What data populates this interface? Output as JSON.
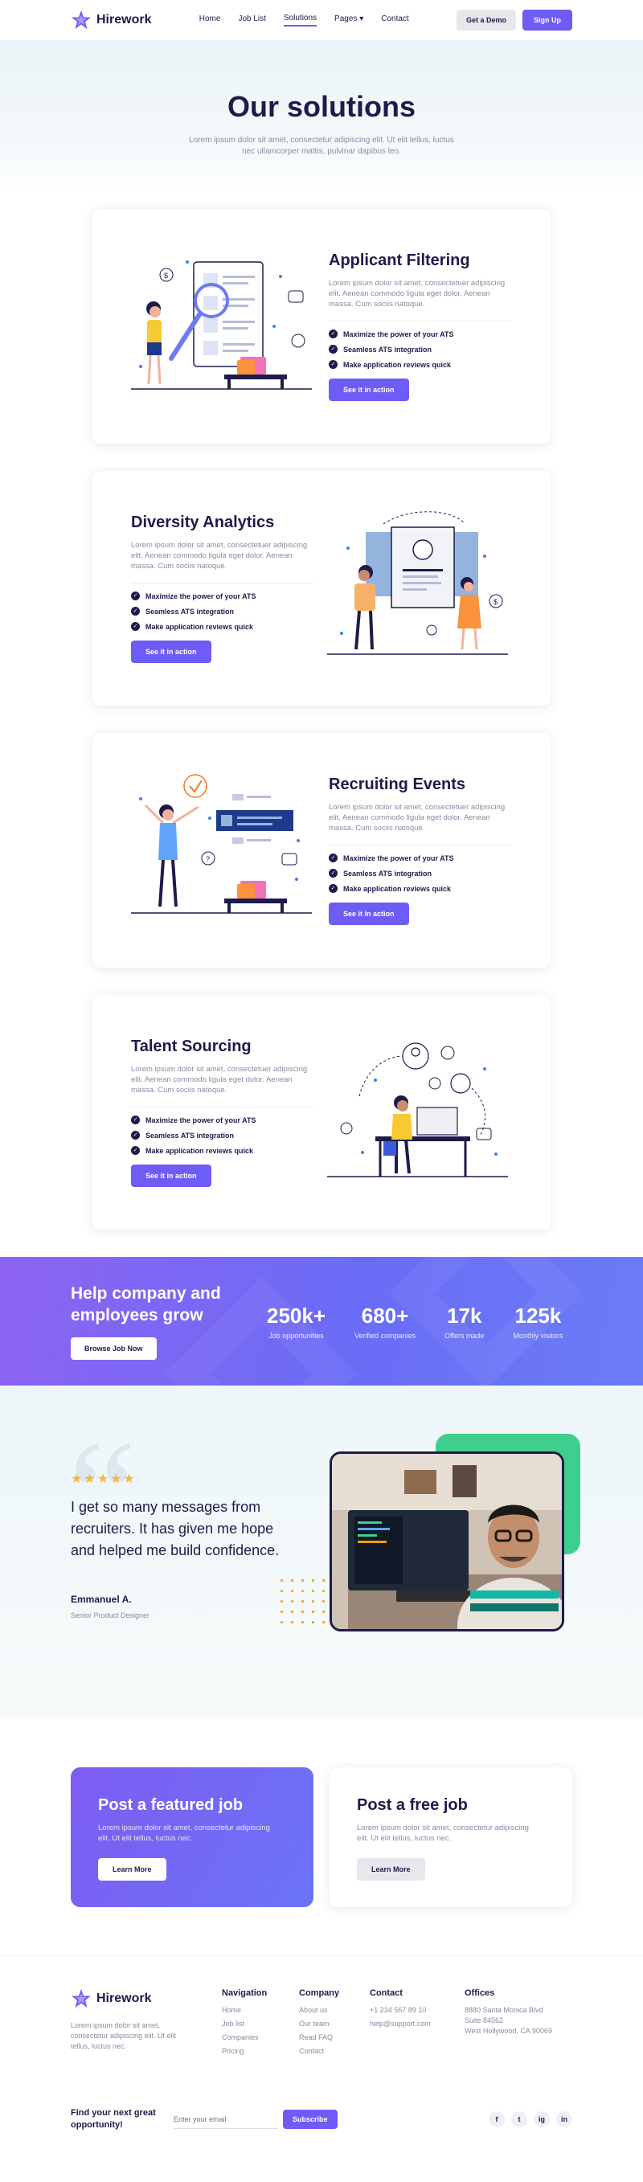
{
  "brand": {
    "name": "Hirework"
  },
  "nav": {
    "links": [
      "Home",
      "Job List",
      "Solutions",
      "Pages",
      "Contact"
    ],
    "demo_label": "Get a Demo",
    "signup_label": "Sign Up"
  },
  "hero": {
    "title": "Our solutions",
    "subtitle": "Lorem ipsum dolor sit amet, consectetur adipiscing elit. Ut elit tellus, luctus nec ullamcorper mattis, pulvinar dapibus leo."
  },
  "cards": [
    {
      "title": "Applicant Filtering",
      "text": "Lorem ipsum dolor sit amet, consectetuer adipiscing elit. Aenean commodo ligula eget dolor. Aenean massa. Cum sociis natoque.",
      "bullets": [
        "Maximize the power of your ATS",
        "Seamless ATS integration",
        "Make application reviews quick"
      ],
      "button": "See it in action"
    },
    {
      "title": "Diversity Analytics",
      "text": "Lorem ipsum dolor sit amet, consectetuer adipiscing elit. Aenean commodo ligula eget dolor. Aenean massa. Cum sociis natoque.",
      "bullets": [
        "Maximize the power of your ATS",
        "Seamless ATS integration",
        "Make application reviews quick"
      ],
      "button": "See it in action"
    },
    {
      "title": "Recruiting Events",
      "text": "Lorem ipsum dolor sit amet, consectetuer adipiscing elit. Aenean commodo ligula eget dolor. Aenean massa. Cum sociis natoque.",
      "bullets": [
        "Maximize the power of your ATS",
        "Seamless ATS integration",
        "Make application reviews quick"
      ],
      "button": "See it in action"
    },
    {
      "title": "Talent Sourcing",
      "text": "Lorem ipsum dolor sit amet, consectetuer adipiscing elit. Aenean commodo ligula eget dolor. Aenean massa. Cum sociis natoque.",
      "bullets": [
        "Maximize the power of your ATS",
        "Seamless ATS integration",
        "Make application reviews quick"
      ],
      "button": "See it in action"
    }
  ],
  "stats": {
    "headline": "Help company and employees grow",
    "button": "Browse Job Now",
    "items": [
      {
        "value": "250k+",
        "label": "Job opportunities"
      },
      {
        "value": "680+",
        "label": "Verified companies"
      },
      {
        "value": "17k",
        "label": "Offers made"
      },
      {
        "value": "125k",
        "label": "Monthly visitors"
      }
    ]
  },
  "testimonial": {
    "rating": 5,
    "quote": "I get so many messages from recruiters. It has given me hope and helped me build confidence.",
    "name": "Emmanuel A.",
    "role": "Senior Product Designer"
  },
  "jobs": {
    "featured": {
      "title": "Post a featured job",
      "text": "Lorem ipsum dolor sit amet, consectetur adipiscing elit. Ut elit tellus, luctus nec.",
      "button": "Learn More"
    },
    "free": {
      "title": "Post a free job",
      "text": "Lorem ipsum dolor sit amet, consectetur adipiscing elit. Ut elit tellus, luctus nec.",
      "button": "Learn More"
    }
  },
  "footer": {
    "about": "Lorem ipsum dolor sit amet, consectetur adipiscing elit. Ut elit tellus, luctus nec.",
    "navigation": {
      "title": "Navigation",
      "items": [
        "Home",
        "Job list",
        "Companies",
        "Pricing"
      ]
    },
    "company": {
      "title": "Company",
      "items": [
        "About us",
        "Our team",
        "Read FAQ",
        "Contact"
      ]
    },
    "contact": {
      "title": "Contact",
      "items": [
        "+1 234 567 89 10",
        "help@support.com"
      ]
    },
    "offices": {
      "title": "Offices",
      "items": [
        "8880 Santa Monica Blvd",
        "Suite 84562",
        "West Hollywood, CA 90069"
      ]
    },
    "newsletter": {
      "cta": "Find your next great opportunity!",
      "placeholder": "Enter your email",
      "button": "Subscribe"
    },
    "social": [
      "f",
      "t",
      "ig",
      "in"
    ]
  },
  "colors": {
    "accent": "#6d5cf5",
    "navy": "#1e1b4b",
    "green": "#3ecf8e",
    "star": "#f5b642"
  }
}
